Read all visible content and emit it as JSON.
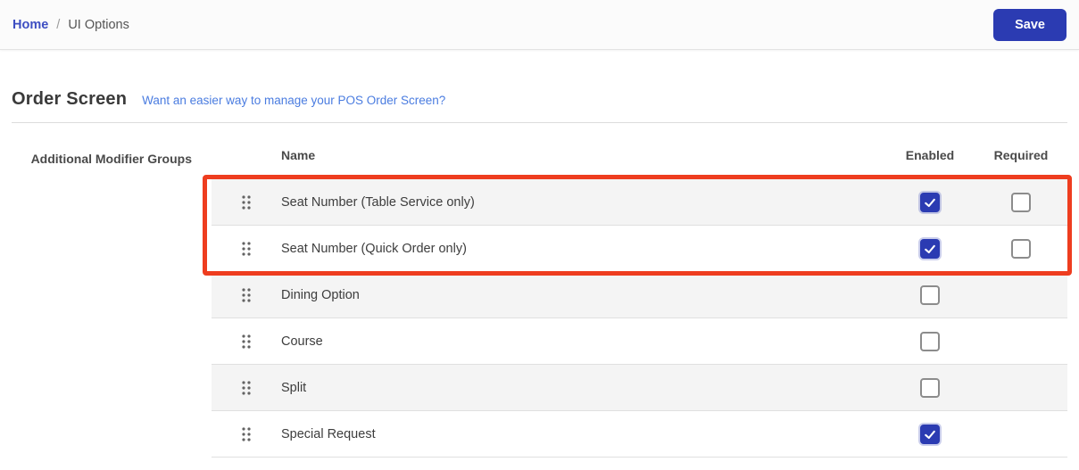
{
  "topbar": {
    "breadcrumb": {
      "home": "Home",
      "separator": "/",
      "current": "UI Options"
    },
    "save_label": "Save"
  },
  "section": {
    "title": "Order Screen",
    "help_link": "Want an easier way to manage your POS Order Screen?"
  },
  "form": {
    "group_label": "Additional Modifier Groups"
  },
  "table": {
    "headers": {
      "name": "Name",
      "enabled": "Enabled",
      "required": "Required"
    },
    "rows": [
      {
        "name": "Seat Number (Table Service only)",
        "enabled": true,
        "required": false,
        "has_required": true
      },
      {
        "name": "Seat Number (Quick Order only)",
        "enabled": true,
        "required": false,
        "has_required": true
      },
      {
        "name": "Dining Option",
        "enabled": false,
        "has_required": false
      },
      {
        "name": "Course",
        "enabled": false,
        "has_required": false
      },
      {
        "name": "Split",
        "enabled": false,
        "has_required": false
      },
      {
        "name": "Special Request",
        "enabled": true,
        "has_required": false
      }
    ]
  },
  "annotation": {
    "highlight_color": "#ee3d1f",
    "highlighted_row_names": [
      "Seat Number (Table Service only)",
      "Seat Number (Quick Order only)"
    ]
  },
  "colors": {
    "primary_blue": "#2b3bb2",
    "link_indigo": "#3d4ec2",
    "help_link_blue": "#4a7ce0",
    "row_alt_gray": "#f4f4f4"
  }
}
